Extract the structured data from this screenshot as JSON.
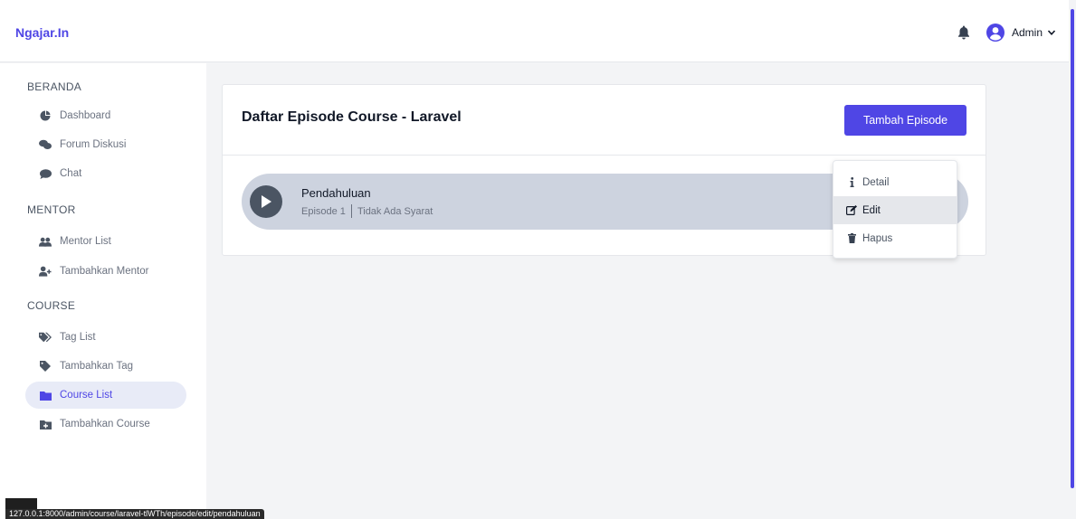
{
  "navbar": {
    "brand": "Ngajar.In",
    "user_name": "Admin",
    "icons": [
      "bell-icon",
      "user-circle-icon",
      "chevron-down-icon"
    ]
  },
  "sidebar": {
    "sections": [
      {
        "title": "BERANDA",
        "items": [
          {
            "label": "Dashboard",
            "icon": "dashboard-icon"
          },
          {
            "label": "Forum Diskusi",
            "icon": "comments-icon"
          },
          {
            "label": "Chat",
            "icon": "chat-icon"
          }
        ]
      },
      {
        "title": "MENTOR",
        "items": [
          {
            "label": "Mentor List",
            "icon": "users-icon"
          },
          {
            "label": "Tambahkan Mentor",
            "icon": "user-plus-icon"
          }
        ]
      },
      {
        "title": "COURSE",
        "items": [
          {
            "label": "Tag List",
            "icon": "tags-icon"
          },
          {
            "label": "Tambahkan Tag",
            "icon": "tag-icon"
          },
          {
            "label": "Course List",
            "icon": "folder-icon",
            "active": true
          },
          {
            "label": "Tambahkan Course",
            "icon": "folder-plus-icon"
          }
        ]
      }
    ]
  },
  "main": {
    "title": "Daftar Episode Course - Laravel",
    "add_button": "Tambah Episode",
    "episodes": [
      {
        "title": "Pendahuluan",
        "episode_label": "Episode 1",
        "requirement": "Tidak Ada Syarat"
      }
    ],
    "dropdown": {
      "items": [
        {
          "label": "Detail",
          "icon": "info-icon"
        },
        {
          "label": "Edit",
          "icon": "edit-icon",
          "hovered": true
        },
        {
          "label": "Hapus",
          "icon": "trash-icon"
        }
      ]
    }
  },
  "status_bar": {
    "url": "127.0.0.1:8000/admin/course/laravel-tlWTh/episode/edit/pendahuluan"
  },
  "colors": {
    "accent": "#4f46e5",
    "episode_bg": "#cdd3df",
    "active_item_bg": "#e8ebf7"
  }
}
